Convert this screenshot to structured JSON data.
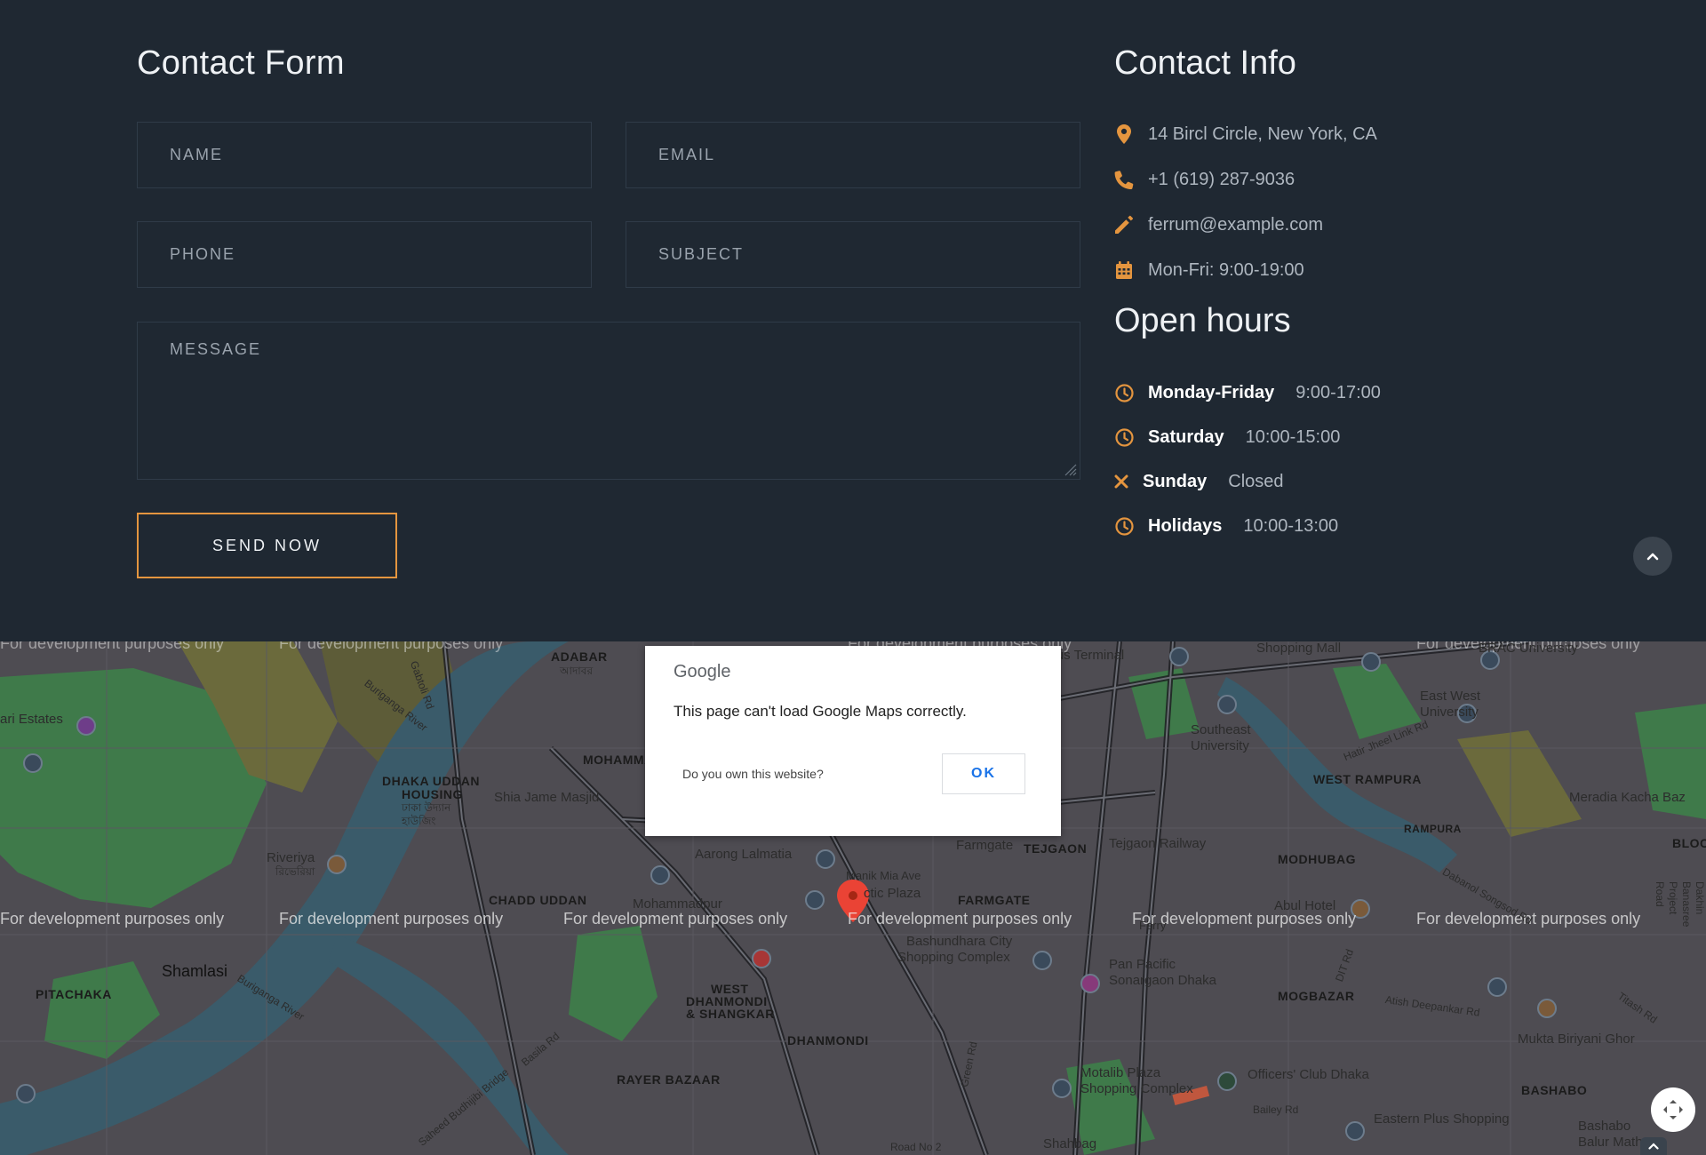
{
  "form": {
    "title": "Contact Form",
    "name_placeholder": "NAME",
    "email_placeholder": "EMAIL",
    "phone_placeholder": "PHONE",
    "subject_placeholder": "SUBJECT",
    "message_placeholder": "MESSAGE",
    "send_label": "SEND NOW"
  },
  "info": {
    "title": "Contact Info",
    "address": "14 Bircl Circle, New York, CA",
    "phone": "+1 (619) 287-9036",
    "email": "ferrum@example.com",
    "schedule": "Mon-Fri: 9:00-19:00"
  },
  "hours": {
    "title": "Open hours",
    "rows": [
      {
        "day": "Monday-Friday",
        "time": "9:00-17:00",
        "icon": "clock-icon"
      },
      {
        "day": "Saturday",
        "time": "10:00-15:00",
        "icon": "clock-icon"
      },
      {
        "day": "Sunday",
        "time": "Closed",
        "icon": "close-icon"
      },
      {
        "day": "Holidays",
        "time": "10:00-13:00",
        "icon": "clock-icon"
      }
    ]
  },
  "colors": {
    "background": "#1f2832",
    "accent": "#e4953f",
    "field_border": "#2f3b48"
  },
  "map": {
    "dev_notice": "For development purposes only",
    "labels": {
      "adabar": "ADABAR",
      "adabar_bn": "আদাবর",
      "dhaka_uddan": "DHAKA UDDAN",
      "housing": "HOUSING",
      "housing_bn": "ঢাকা উদ্যান হাউজিং",
      "chadd_uddan": "CHADD UDDAN",
      "shamlasi": "Shamlasi",
      "pitachaka": "PITACHAKA",
      "riveriya": "Riveriya",
      "riveriya_bn": "রিভেরিয়া",
      "shia_masjid": "Shia Jame Masjid",
      "mohammadpur": "Mohammadpur",
      "aarong": "Aarong Lalmatia",
      "manik_mia": "Manik Mia Ave",
      "plaza": "ctic Plaza",
      "farmgate": "Farmgate",
      "farmgate_caps": "FARMGATE",
      "tejgaon": "TEJGAON",
      "tejgaon_rw": "Tejgaon Railway",
      "bashundhara": "Bashundhara City",
      "shopping_complex": "Shopping Complex",
      "west_dhanmondi": "WEST",
      "dhanmondi_shangkar": "DHANMONDI",
      "and_shangkar": "& SHANGKAR",
      "dhanmondi": "DHANMONDI",
      "rayer_bazaar": "RAYER BAZAAR",
      "pan_pacific": "Pan Pacific",
      "sonargaon": "Sonargaon Dhaka",
      "mogbazar": "MOGBAZAR",
      "motalib": "Motalib Plaza",
      "motalib_sc": "Shopping Complex",
      "officers_club": "Officers' Club Dhaka",
      "southeast": "Southeast",
      "university": "University",
      "east_west": "East West",
      "east_west_u": "University",
      "brac": "BRAC University",
      "west_rampura": "WEST RAMPURA",
      "rampura": "RAMPURA",
      "modhubag": "MODHUBAG",
      "abul_hotel": "Abul Hotel",
      "bus_terminal": "li Bus Terminal",
      "shopping_mall": "Shopping Mall",
      "meradia": "Meradia Kacha Baz",
      "bashabo": "BASHABO",
      "mukta": "Mukta Biriyani Ghor",
      "eastern_plus": "Eastern Plus Shopping",
      "bashabo_balur": "Bashabo",
      "balur_math": "Balur Math",
      "shahbag": "Shahbag",
      "bailey_rd": "Bailey Rd",
      "estates": "ari Estates",
      "gabtoli_rd": "Gabtoli Rd",
      "buriganga": "Buriganga River",
      "buriganga2": "Buriganga River",
      "basila_rd": "Basila Rd",
      "bridge": "Saheed Budhijibi Bridge",
      "green_rd": "Green Rd",
      "dit_rd": "DIT Rd",
      "hatir_jheel": "Hatir Jheel Link Rd",
      "atish": "Atish Deepankar Rd",
      "titash": "Titash Rd",
      "dabanol": "Dabanol Songsod Rd",
      "dakhin": "Dakhin Banasree Project Road",
      "mohamma": "MOHAMMA",
      "bloc": "BLOC",
      "ferry": "Ferry",
      "road_no2": "Road No 2"
    }
  },
  "dialog": {
    "brand": "Google",
    "message": "This page can't load Google Maps correctly.",
    "own_site": "Do you own this website?",
    "ok_label": "OK"
  }
}
